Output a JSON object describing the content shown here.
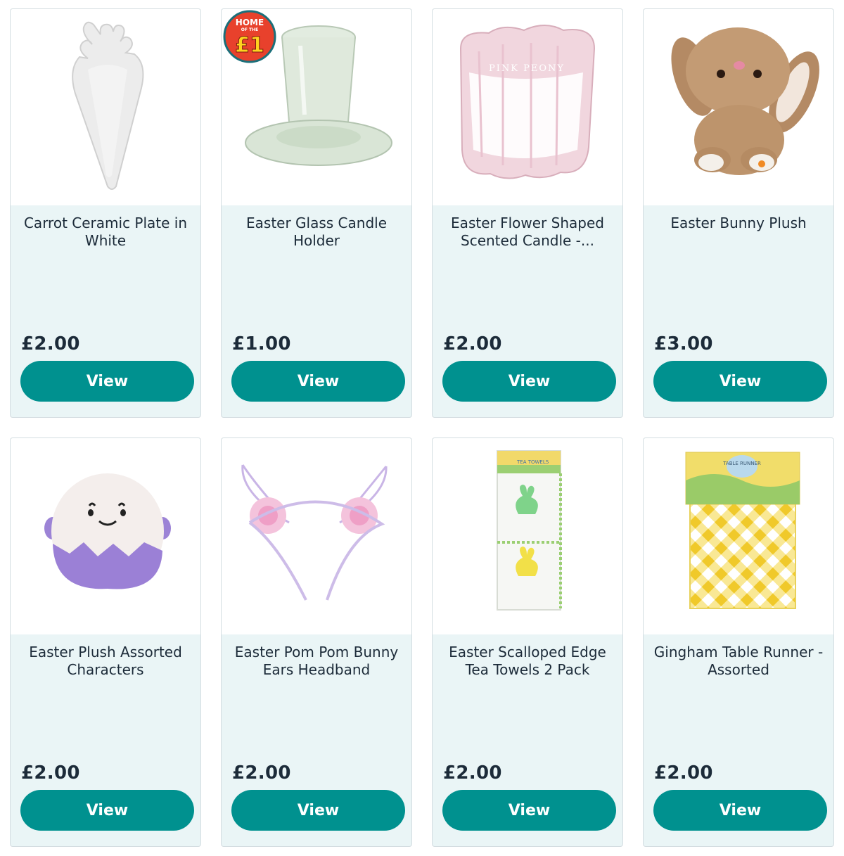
{
  "products": [
    {
      "title": "Carrot Ceramic Plate in White",
      "price": "£2.00",
      "button": "View",
      "image": "carrot-plate-image"
    },
    {
      "title": "Easter Glass Candle Holder",
      "price": "£1.00",
      "button": "View",
      "image": "glass-candle-holder-image",
      "badge": {
        "top": "HOME",
        "middle": "OF THE",
        "value": "£1"
      }
    },
    {
      "title": "Easter Flower Shaped Scented Candle -...",
      "price": "£2.00",
      "button": "View",
      "image": "flower-candle-image",
      "image_text": "PINK PEONY"
    },
    {
      "title": "Easter Bunny Plush",
      "price": "£3.00",
      "button": "View",
      "image": "bunny-plush-image"
    },
    {
      "title": "Easter Plush Assorted Characters",
      "price": "£2.00",
      "button": "View",
      "image": "egg-plush-image"
    },
    {
      "title": "Easter Pom Pom Bunny Ears Headband",
      "price": "£2.00",
      "button": "View",
      "image": "bunny-ears-headband-image"
    },
    {
      "title": "Easter Scalloped Edge Tea Towels 2 Pack",
      "price": "£2.00",
      "button": "View",
      "image": "tea-towels-image",
      "image_text": "TEA TOWELS"
    },
    {
      "title": "Gingham Table Runner - Assorted",
      "price": "£2.00",
      "button": "View",
      "image": "table-runner-image",
      "image_text": "TABLE RUNNER"
    }
  ],
  "colors": {
    "button": "#00918f",
    "card_bg": "#eaf5f6",
    "text": "#1c2b39",
    "badge": "#e8412c"
  }
}
